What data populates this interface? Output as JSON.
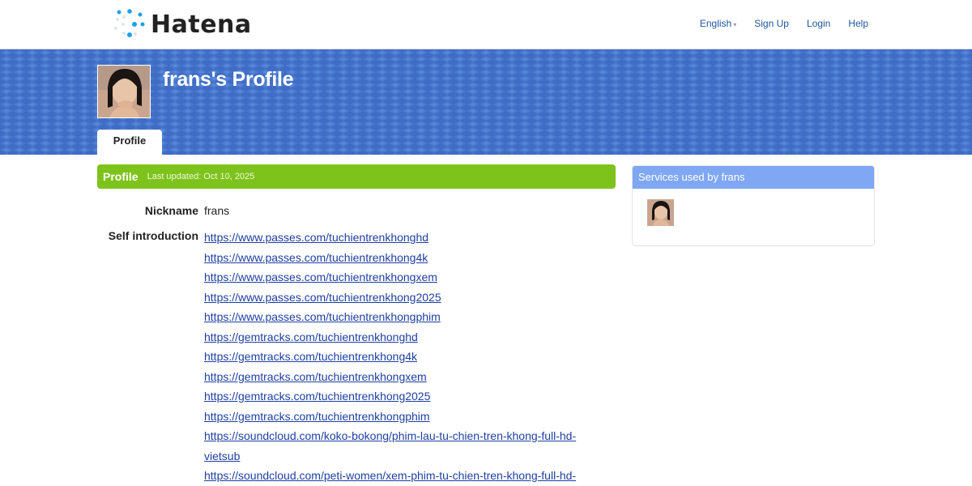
{
  "header": {
    "logo_text": "Hatena",
    "nav": {
      "language": "English",
      "sign_up": "Sign Up",
      "login": "Login",
      "help": "Help"
    }
  },
  "banner": {
    "title": "frans's Profile",
    "tab_label": "Profile"
  },
  "profile": {
    "section_title": "Profile",
    "last_updated": "Last updated: Oct 10, 2025",
    "nickname_label": "Nickname",
    "nickname_value": "frans",
    "self_intro_label": "Self introduction",
    "links": [
      "https://www.passes.com/tuchientrenkhonghd",
      "https://www.passes.com/tuchientrenkhong4k",
      "https://www.passes.com/tuchientrenkhongxem",
      "https://www.passes.com/tuchientrenkhong2025",
      "https://www.passes.com/tuchientrenkhongphim",
      "https://gemtracks.com/tuchientrenkhonghd",
      "https://gemtracks.com/tuchientrenkhong4k",
      "https://gemtracks.com/tuchientrenkhongxem",
      "https://gemtracks.com/tuchientrenkhong2025",
      "https://gemtracks.com/tuchientrenkhongphim",
      "https://soundcloud.com/koko-bokong/phim-lau-tu-chien-tren-khong-full-hd-",
      "vietsub",
      "https://soundcloud.com/peti-women/xem-phim-tu-chien-tren-khong-full-hd-"
    ]
  },
  "sidebar": {
    "title": "Services used by frans"
  },
  "colors": {
    "banner_blue": "#3f6cc4",
    "section_green": "#7dc31b",
    "sidebar_header_blue": "#7fa7f4",
    "link_blue": "#1e3fa0",
    "logo_dot_blue": "#1da1e8"
  }
}
